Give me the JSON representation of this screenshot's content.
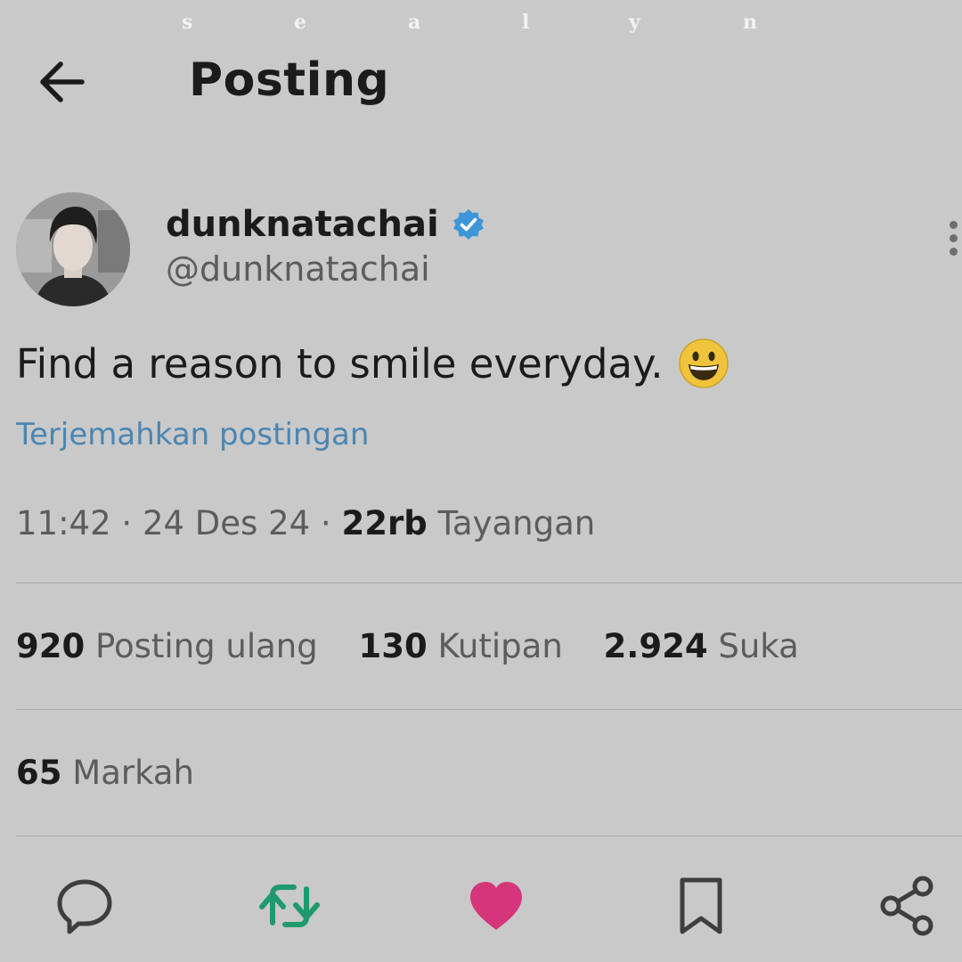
{
  "watermark": {
    "letters": [
      "s",
      "e",
      "a",
      "l",
      "y",
      "n"
    ]
  },
  "header": {
    "back_icon": "arrow-left-icon",
    "title": "Posting"
  },
  "author": {
    "display_name": "dunknatachai",
    "verified_icon": "verified-badge-icon",
    "handle": "@dunknatachai",
    "more_icon": "more-vertical-icon"
  },
  "post": {
    "text": "Find a reason to smile everyday.",
    "emoji_icon": "grinning-face-emoji",
    "translate_link": "Terjemahkan postingan",
    "time": "11:42",
    "separator": "·",
    "date": "24 Des 24",
    "views_count": "22rb",
    "views_label": "Tayangan"
  },
  "stats": {
    "reposts_count": "920",
    "reposts_label": "Posting ulang",
    "quotes_count": "130",
    "quotes_label": "Kutipan",
    "likes_count": "2.924",
    "likes_label": "Suka",
    "bookmarks_count": "65",
    "bookmarks_label": "Markah"
  },
  "actions": {
    "reply_icon": "reply-icon",
    "repost_icon": "repost-icon",
    "like_icon": "heart-icon",
    "bookmark_icon": "bookmark-icon",
    "share_icon": "share-icon"
  },
  "colors": {
    "background": "#c9c9c9",
    "link": "#4a86b3",
    "verified": "#3e96d8",
    "repost_active": "#1f9a6e",
    "like_active": "#d6357a"
  }
}
